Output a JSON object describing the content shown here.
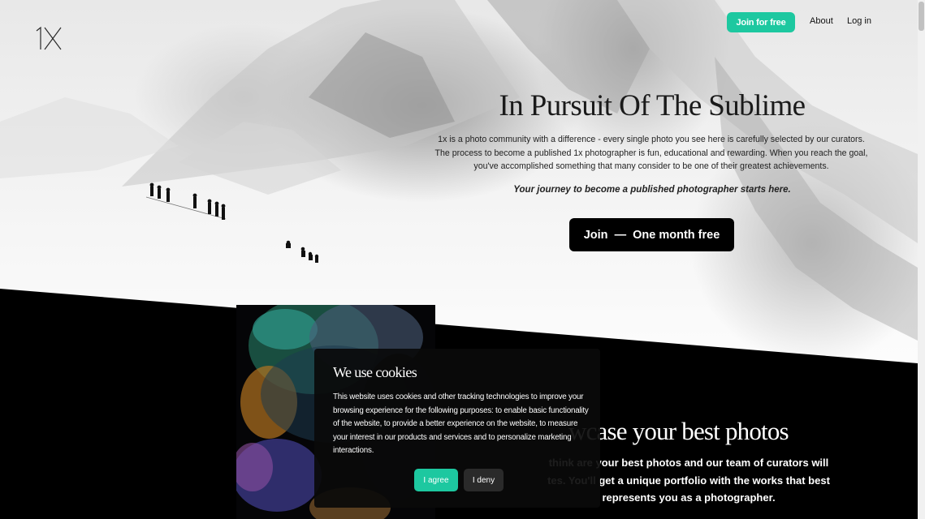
{
  "nav": {
    "logo": "1x",
    "join_label": "Join for free",
    "about_label": "About",
    "login_label": "Log in"
  },
  "hero": {
    "title": "In Pursuit Of The Sublime",
    "description": "1x is a photo community with a difference - every single photo you see here is carefully selected by our curators. The process to become a published 1x photographer is fun, educational and rewarding. When you reach the goal, you've accomplished something that many consider to be one of their greatest achievements.",
    "tagline": "Your journey to become a published photographer starts here.",
    "cta_label": "Join  —  One month free"
  },
  "showcase": {
    "title_visible": "wcase your best photos",
    "description_visible": "think are your best photos and our team of curators will\ntes. You'll get a unique portfolio with the works that best\nrepresents you as a photographer."
  },
  "cookie": {
    "title": "We use cookies",
    "body": "This website uses cookies and other tracking technologies to improve your browsing experience for the following purposes: to enable basic functionality of the website, to provide a better experience on the website, to measure your interest in our products and services and to personalize marketing interactions.",
    "agree_label": "I agree",
    "deny_label": "I deny"
  },
  "colors": {
    "accent": "#1dc8a0",
    "dark": "#000000",
    "text": "#222222"
  }
}
